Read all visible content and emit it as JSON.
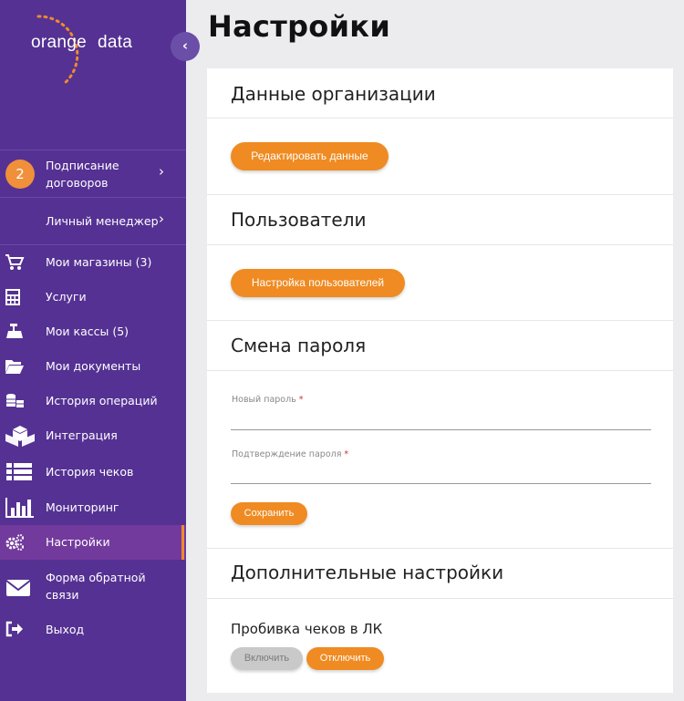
{
  "logo": {
    "part1": "orange",
    "part2": "data"
  },
  "collapse_icon": "chevron-left-icon",
  "sidebar": {
    "badge": "2",
    "items": [
      {
        "label": "Подписание договоров",
        "icon": "badge"
      },
      {
        "label": "Личный менеджер",
        "icon": "none"
      },
      {
        "label": "Мои магазины (3)",
        "icon": "cart-icon"
      },
      {
        "label": "Услуги",
        "icon": "calculator-icon"
      },
      {
        "label": "Мои кассы (5)",
        "icon": "register-icon"
      },
      {
        "label": "Мои документы",
        "icon": "folder-icon"
      },
      {
        "label": "История операций",
        "icon": "coins-icon"
      },
      {
        "label": "Интеграция",
        "icon": "cubes-icon"
      },
      {
        "label": "История чеков",
        "icon": "list-icon"
      },
      {
        "label": "Мониторинг",
        "icon": "bar-chart-icon"
      },
      {
        "label": "Настройки",
        "icon": "gears-icon"
      },
      {
        "label": "Форма обратной связи",
        "icon": "envelope-icon"
      },
      {
        "label": "Выход",
        "icon": "sign-out-icon"
      }
    ]
  },
  "page": {
    "title": "Настройки"
  },
  "org": {
    "title": "Данные организации",
    "edit_button": "Редактировать данные"
  },
  "users": {
    "title": "Пользователи",
    "settings_button": "Настройка пользователей"
  },
  "password": {
    "title": "Смена пароля",
    "new_label": "Новый пароль",
    "confirm_label": "Подтверждение пароля",
    "required_mark": "*",
    "save_button": "Сохранить"
  },
  "extra": {
    "title": "Дополнительные настройки",
    "receipts_label": "Пробивка чеков в ЛК",
    "enable_button": "Включить",
    "disable_button": "Отключить"
  },
  "colors": {
    "sidebar": "#553193",
    "accent": "#ef8b22",
    "active": "#733a9d"
  }
}
